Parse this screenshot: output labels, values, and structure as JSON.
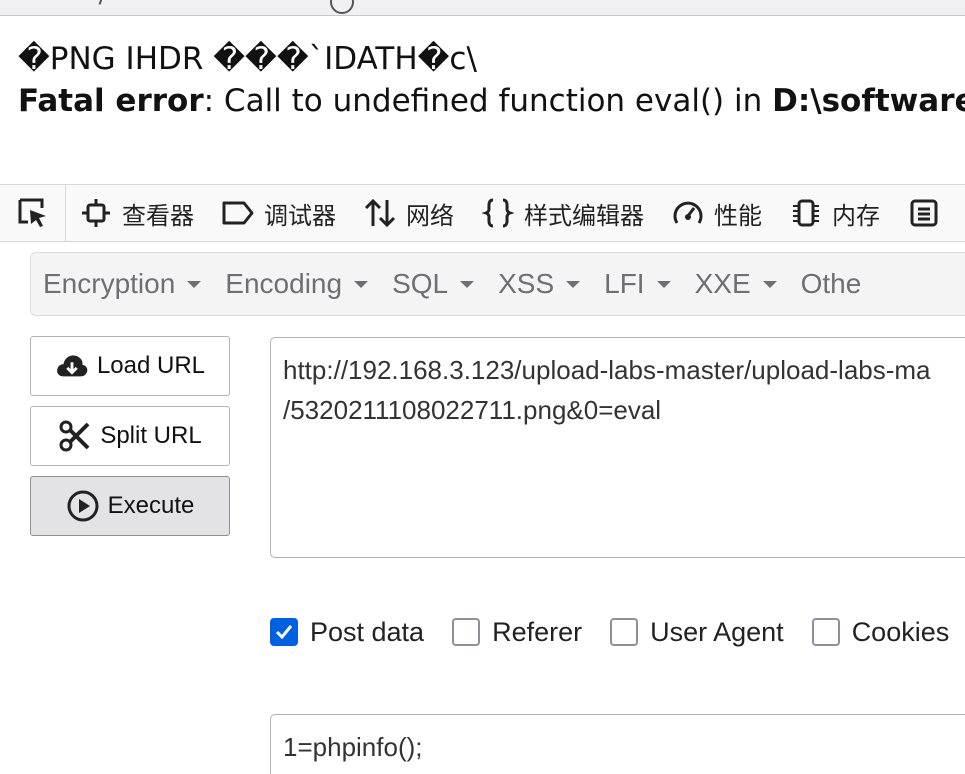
{
  "output": {
    "line1": "�PNG  IHDR ���`IDATH�c\\",
    "error_label": "Fatal error",
    "error_message": ": Call to undefined function eval() in ",
    "error_path": "D:\\software\\p"
  },
  "devtools": {
    "tabs": [
      {
        "label": "查看器",
        "icon": "inspector-icon"
      },
      {
        "label": "调试器",
        "icon": "debugger-icon"
      },
      {
        "label": "网络",
        "icon": "network-icon"
      },
      {
        "label": "样式编辑器",
        "icon": "style-editor-icon"
      },
      {
        "label": "性能",
        "icon": "performance-icon"
      },
      {
        "label": "内存",
        "icon": "memory-icon"
      }
    ]
  },
  "hackbar": {
    "menu": [
      "Encryption",
      "Encoding",
      "SQL",
      "XSS",
      "LFI",
      "XXE",
      "Othe"
    ],
    "buttons": {
      "load": "Load URL",
      "split": "Split URL",
      "execute": "Execute"
    },
    "url": "http://192.168.3.123/upload-labs-master/upload-labs-ma\n/5320211108022711.png&0=eval",
    "checkboxes": [
      {
        "label": "Post data",
        "checked": true
      },
      {
        "label": "Referer",
        "checked": false
      },
      {
        "label": "User Agent",
        "checked": false
      },
      {
        "label": "Cookies",
        "checked": false
      }
    ],
    "post_data": "1=phpinfo();"
  }
}
